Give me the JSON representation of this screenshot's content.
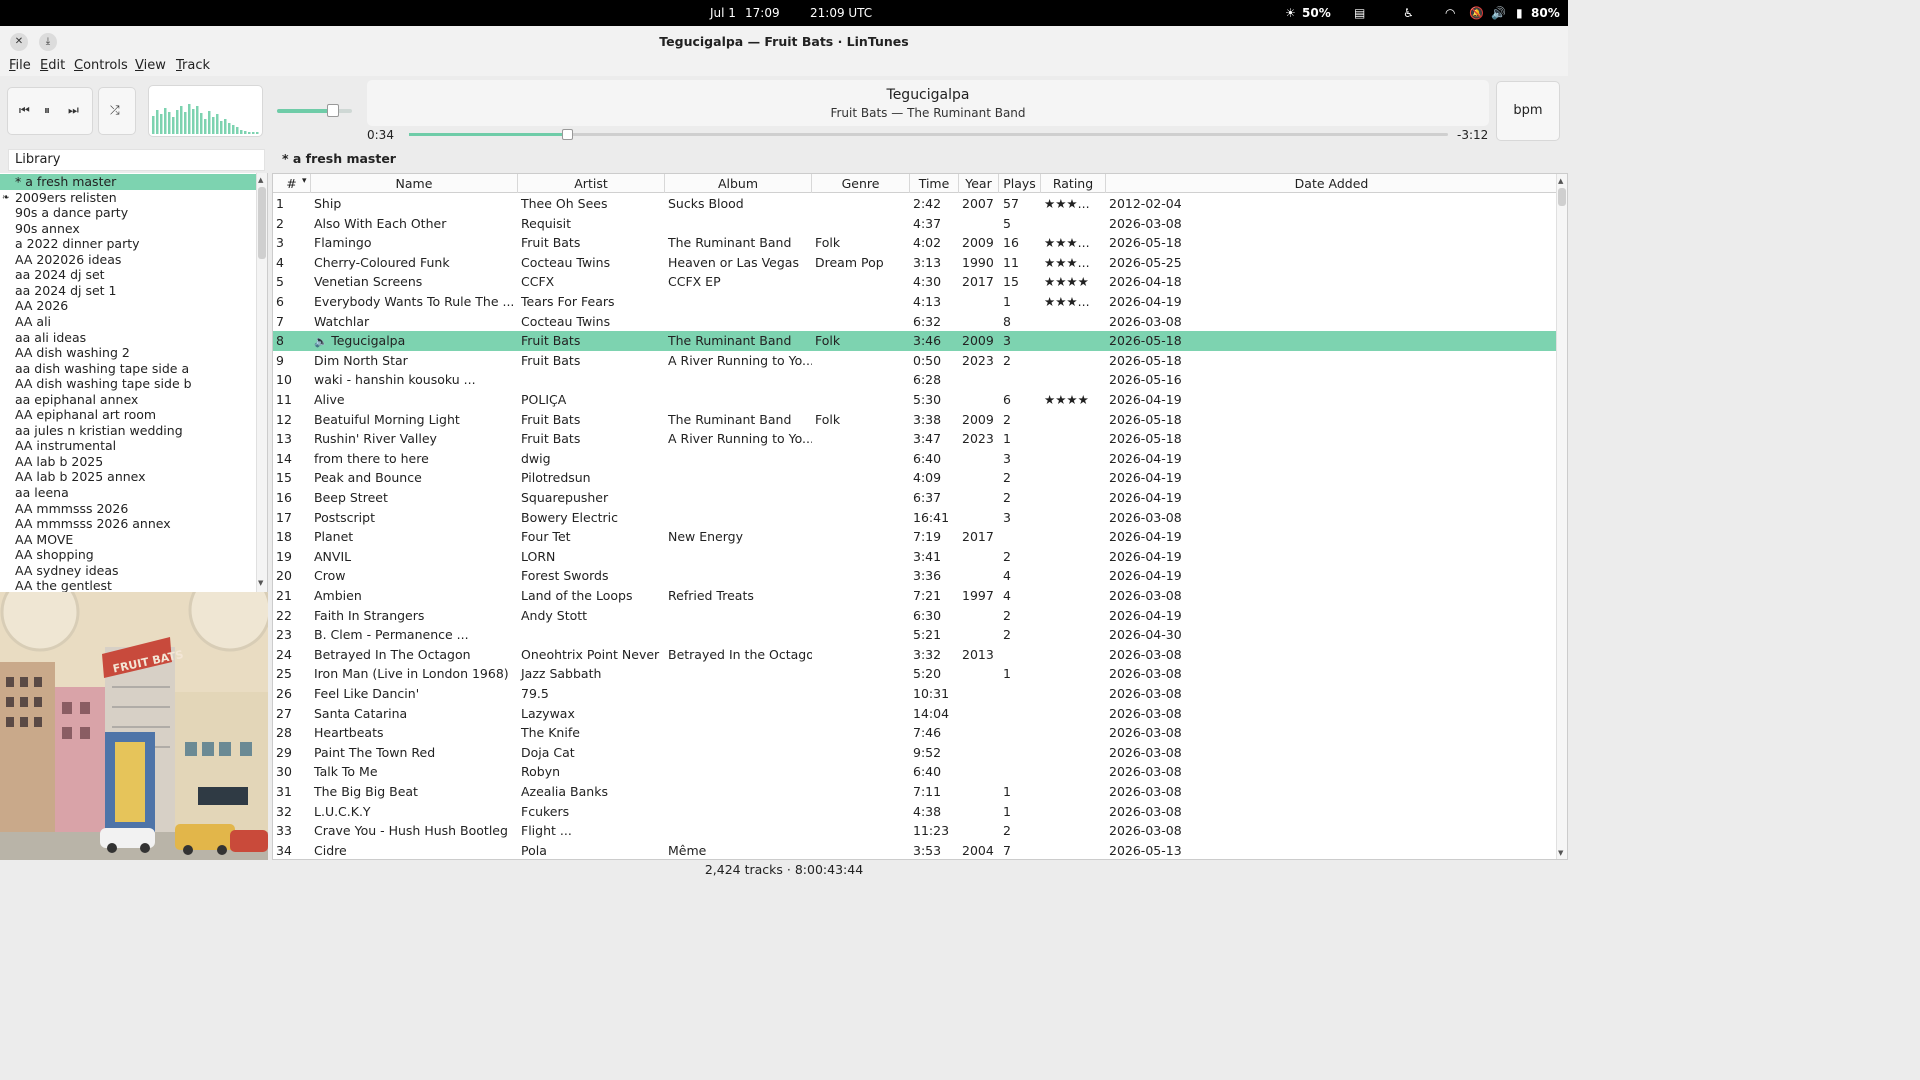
{
  "system": {
    "date": "Jul 1",
    "time": "17:09",
    "utc": "21:09 UTC",
    "brightness": "50%",
    "battery": "80%"
  },
  "window": {
    "title": "Tegucigalpa — Fruit Bats · LinTunes"
  },
  "menu": [
    "File",
    "Edit",
    "Controls",
    "View",
    "Track"
  ],
  "player": {
    "volume_fraction": 0.75,
    "track_title": "Tegucigalpa",
    "track_subtitle": "Fruit Bats — The Ruminant Band",
    "elapsed": "0:34",
    "remaining": "-3:12",
    "progress_fraction": 0.15,
    "bpm_label": "bpm"
  },
  "sidebar": {
    "header": "Library",
    "items": [
      "* a fresh master",
      "2009ers relisten",
      "90s a dance party",
      "90s annex",
      "a 2022 dinner party",
      "AA 202026 ideas",
      "aa 2024 dj set",
      "aa 2024 dj set 1",
      "AA 2026",
      "AA ali",
      "aa ali ideas",
      "AA dish washing 2",
      "aa dish washing tape side a",
      "AA dish washing tape side b",
      "aa epiphanal annex",
      "AA epiphanal art room",
      "aa jules n kristian wedding",
      "AA instrumental",
      "AA lab b 2025",
      "AA lab b 2025 annex",
      "aa leena",
      "AA mmmsss 2026",
      "AA mmmsss 2026  annex",
      "AA MOVE",
      "AA shopping",
      "AA sydney ideas",
      "AA the gentlest"
    ]
  },
  "playlist": {
    "title": "* a fresh master"
  },
  "columns": [
    "#",
    "Name",
    "Artist",
    "Album",
    "Genre",
    "Time",
    "Year",
    "Plays",
    "Rating",
    "Date Added"
  ],
  "tracks": [
    [
      "1",
      "Ship",
      "Thee Oh Sees",
      "Sucks Blood",
      "",
      "2:42",
      "2007",
      "57",
      "★★★...",
      "2012-02-04"
    ],
    [
      "2",
      "Also With Each Other",
      "Requisit",
      "",
      "",
      "4:37",
      "",
      "5",
      "",
      "2026-03-08"
    ],
    [
      "3",
      "Flamingo",
      "Fruit Bats",
      "The Ruminant Band",
      "Folk",
      "4:02",
      "2009",
      "16",
      "★★★...",
      "2026-05-18"
    ],
    [
      "4",
      "Cherry-Coloured Funk",
      "Cocteau Twins",
      "Heaven or Las Vegas",
      "Dream Pop",
      "3:13",
      "1990",
      "11",
      "★★★...",
      "2026-05-25"
    ],
    [
      "5",
      "Venetian Screens",
      "CCFX",
      "CCFX EP",
      "",
      "4:30",
      "2017",
      "15",
      "★★★★",
      "2026-04-18"
    ],
    [
      "6",
      "Everybody Wants To Rule The ...",
      "Tears For Fears",
      "",
      "",
      "4:13",
      "",
      "1",
      "★★★...",
      "2026-04-19"
    ],
    [
      "7",
      "Watchlar",
      "Cocteau Twins",
      "",
      "",
      "6:32",
      "",
      "8",
      "",
      "2026-03-08"
    ],
    [
      "8",
      "Tegucigalpa",
      "Fruit Bats",
      "The Ruminant Band",
      "Folk",
      "3:46",
      "2009",
      "3",
      "",
      "2026-05-18"
    ],
    [
      "9",
      "Dim North Star",
      "Fruit Bats",
      "A River Running to Yo...",
      "",
      "0:50",
      "2023",
      "2",
      "",
      "2026-05-18"
    ],
    [
      "10",
      "waki - hanshin kousoku ...",
      "",
      "",
      "",
      "6:28",
      "",
      "",
      "",
      "2026-05-16"
    ],
    [
      "11",
      "Alive",
      "POLIÇA",
      "",
      "",
      "5:30",
      "",
      "6",
      "★★★★",
      "2026-04-19"
    ],
    [
      "12",
      "Beatuiful Morning Light",
      "Fruit Bats",
      "The Ruminant Band",
      "Folk",
      "3:38",
      "2009",
      "2",
      "",
      "2026-05-18"
    ],
    [
      "13",
      "Rushin' River Valley",
      "Fruit Bats",
      "A River Running to Yo...",
      "",
      "3:47",
      "2023",
      "1",
      "",
      "2026-05-18"
    ],
    [
      "14",
      "from there to here",
      "dwig",
      "",
      "",
      "6:40",
      "",
      "3",
      "",
      "2026-04-19"
    ],
    [
      "15",
      "Peak and Bounce",
      "Pilotredsun",
      "",
      "",
      "4:09",
      "",
      "2",
      "",
      "2026-04-19"
    ],
    [
      "16",
      "Beep Street",
      "Squarepusher",
      "",
      "",
      "6:37",
      "",
      "2",
      "",
      "2026-04-19"
    ],
    [
      "17",
      "Postscript",
      "Bowery Electric",
      "",
      "",
      "16:41",
      "",
      "3",
      "",
      "2026-03-08"
    ],
    [
      "18",
      "Planet",
      "Four Tet",
      "New Energy",
      "",
      "7:19",
      "2017",
      "",
      "",
      "2026-04-19"
    ],
    [
      "19",
      "ANVIL",
      "LORN",
      "",
      "",
      "3:41",
      "",
      "2",
      "",
      "2026-04-19"
    ],
    [
      "20",
      "Crow",
      "Forest Swords",
      "",
      "",
      "3:36",
      "",
      "4",
      "",
      "2026-04-19"
    ],
    [
      "21",
      "Ambien",
      "Land of the Loops",
      "Refried Treats",
      "",
      "7:21",
      "1997",
      "4",
      "",
      "2026-03-08"
    ],
    [
      "22",
      "Faith In Strangers",
      "Andy Stott",
      "",
      "",
      "6:30",
      "",
      "2",
      "",
      "2026-04-19"
    ],
    [
      "23",
      "B. Clem - Permanence ...",
      "",
      "",
      "",
      "5:21",
      "",
      "2",
      "",
      "2026-04-30"
    ],
    [
      "24",
      "Betrayed In The Octagon",
      "Oneohtrix Point Never",
      "Betrayed In the Octagon",
      "",
      "3:32",
      "2013",
      "",
      "",
      "2026-03-08"
    ],
    [
      "25",
      "Iron Man (Live in London 1968)",
      "Jazz Sabbath",
      "",
      "",
      "5:20",
      "",
      "1",
      "",
      "2026-03-08"
    ],
    [
      "26",
      "Feel Like Dancin'",
      "79.5",
      "",
      "",
      "10:31",
      "",
      "",
      "",
      "2026-03-08"
    ],
    [
      "27",
      "Santa Catarina",
      "Lazywax",
      "",
      "",
      "14:04",
      "",
      "",
      "",
      "2026-03-08"
    ],
    [
      "28",
      "Heartbeats",
      "The Knife",
      "",
      "",
      "7:46",
      "",
      "",
      "",
      "2026-03-08"
    ],
    [
      "29",
      "Paint The Town Red",
      "Doja Cat",
      "",
      "",
      "9:52",
      "",
      "",
      "",
      "2026-03-08"
    ],
    [
      "30",
      "Talk To Me",
      "Robyn",
      "",
      "",
      "6:40",
      "",
      "",
      "",
      "2026-03-08"
    ],
    [
      "31",
      "The Big Big Beat",
      "Azealia Banks",
      "",
      "",
      "7:11",
      "",
      "1",
      "",
      "2026-03-08"
    ],
    [
      "32",
      "L.U.C.K.Y",
      "Fcukers",
      "",
      "",
      "4:38",
      "",
      "1",
      "",
      "2026-03-08"
    ],
    [
      "33",
      "Crave You - Hush Hush Bootleg",
      "Flight ...",
      "",
      "",
      "11:23",
      "",
      "2",
      "",
      "2026-03-08"
    ],
    [
      "34",
      "Cidre",
      "Pola",
      "Même",
      "",
      "3:53",
      "2004",
      "7",
      "",
      "2026-05-13"
    ]
  ],
  "playing_index": 7,
  "album_art": {
    "text": "FRUIT BATS"
  },
  "status": "2,424 tracks · 8:00:43:44",
  "colors": {
    "accent": "#7dd3b0"
  }
}
